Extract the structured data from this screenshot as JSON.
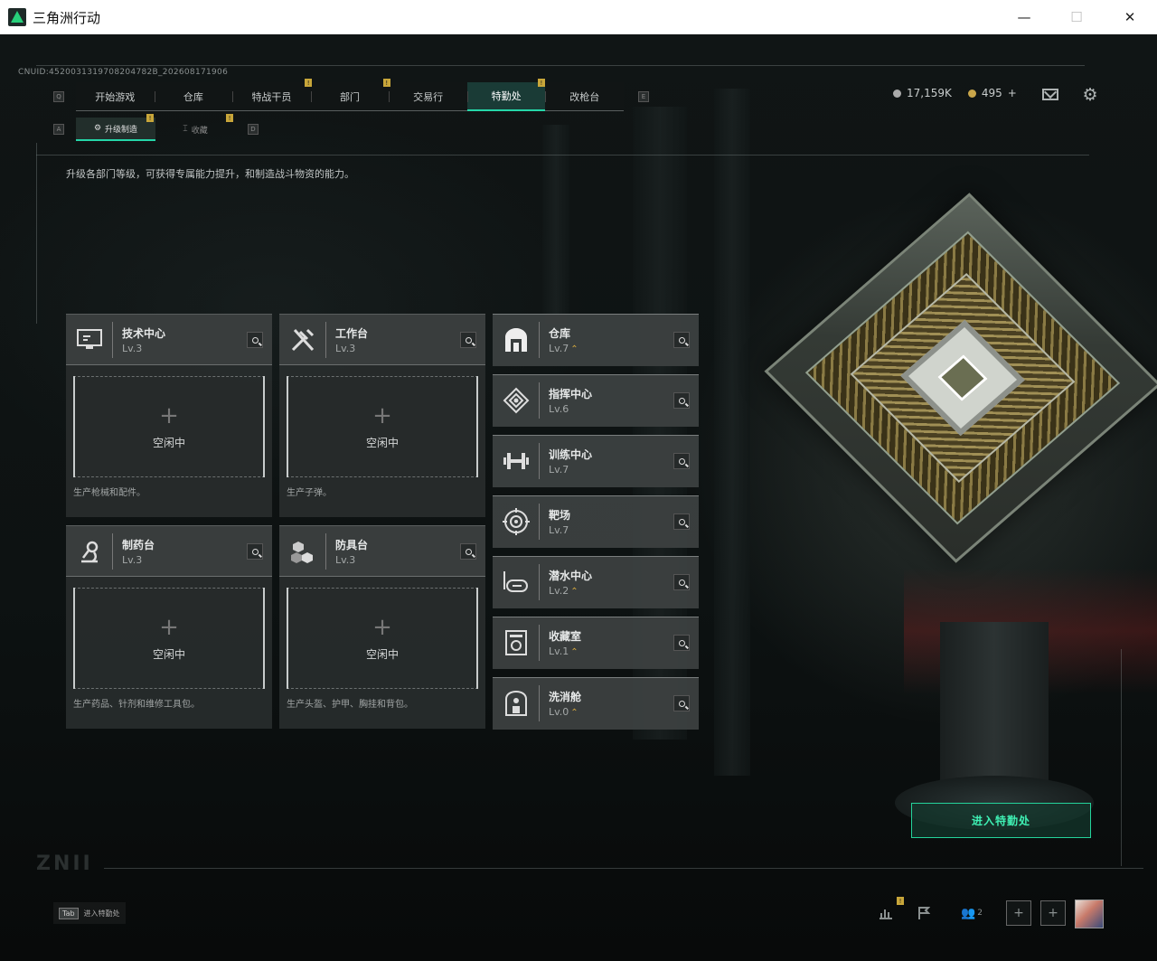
{
  "window": {
    "title": "三角洲行动",
    "minimize": "—",
    "maximize": "☐",
    "close": "✕"
  },
  "uid": "CNUID:4520031319708204782B_202608171906",
  "keys": {
    "left_top": "Q",
    "right_top": "E",
    "left_sub": "A",
    "right_sub": "D"
  },
  "nav": {
    "tabs": [
      {
        "label": "开始游戏",
        "badge": ""
      },
      {
        "label": "仓库",
        "badge": ""
      },
      {
        "label": "特战干员",
        "badge": "!"
      },
      {
        "label": "部门",
        "badge": "!"
      },
      {
        "label": "交易行",
        "badge": ""
      },
      {
        "label": "特勤处",
        "badge": "!"
      },
      {
        "label": "改枪台",
        "badge": ""
      }
    ],
    "active": "特勤处"
  },
  "subnav": {
    "tabs": [
      {
        "label": "升级制造",
        "badge": "!"
      },
      {
        "label": "收藏",
        "badge": "!"
      }
    ]
  },
  "currency": {
    "silver": "17,159K",
    "gold": "495",
    "add": "+"
  },
  "description": "升级各部门等级，可获得专属能力提升，和制造战斗物资的能力。",
  "workbenches": [
    {
      "name": "技术中心",
      "level": "Lv.3",
      "icon": "computer-icon",
      "status": "空闲中",
      "note": "生产枪械和配件。"
    },
    {
      "name": "工作台",
      "level": "Lv.3",
      "icon": "tools-icon",
      "status": "空闲中",
      "note": "生产子弹。"
    },
    {
      "name": "制药台",
      "level": "Lv.3",
      "icon": "microscope-icon",
      "status": "空闲中",
      "note": "生产药品、针剂和维修工具包。"
    },
    {
      "name": "防具台",
      "level": "Lv.3",
      "icon": "armor-blocks-icon",
      "status": "空闲中",
      "note": "生产头盔、护甲、胸挂和背包。"
    }
  ],
  "departments": [
    {
      "name": "仓库",
      "level": "Lv.7",
      "upgrade": "⌃",
      "icon": "warehouse-icon"
    },
    {
      "name": "指挥中心",
      "level": "Lv.6",
      "upgrade": "",
      "icon": "command-icon"
    },
    {
      "name": "训练中心",
      "level": "Lv.7",
      "upgrade": "",
      "icon": "dumbbell-icon"
    },
    {
      "name": "靶场",
      "level": "Lv.7",
      "upgrade": "",
      "icon": "target-icon"
    },
    {
      "name": "潜水中心",
      "level": "Lv.2",
      "upgrade": "⌃",
      "icon": "diving-mask-icon"
    },
    {
      "name": "收藏室",
      "level": "Lv.1",
      "upgrade": "⌃",
      "icon": "collection-icon"
    },
    {
      "name": "洗消舱",
      "level": "Lv.0",
      "upgrade": "⌃",
      "icon": "decontamination-icon"
    }
  ],
  "enter_button": "进入特勤处",
  "tab_hint": {
    "key": "Tab",
    "label": "进入特勤处"
  },
  "bottom_bar": {
    "squad_count": "2",
    "badge": "!"
  },
  "colors": {
    "accent": "#25d6a8",
    "badge": "#c8a63a",
    "upgrade": "#d6a93e"
  }
}
